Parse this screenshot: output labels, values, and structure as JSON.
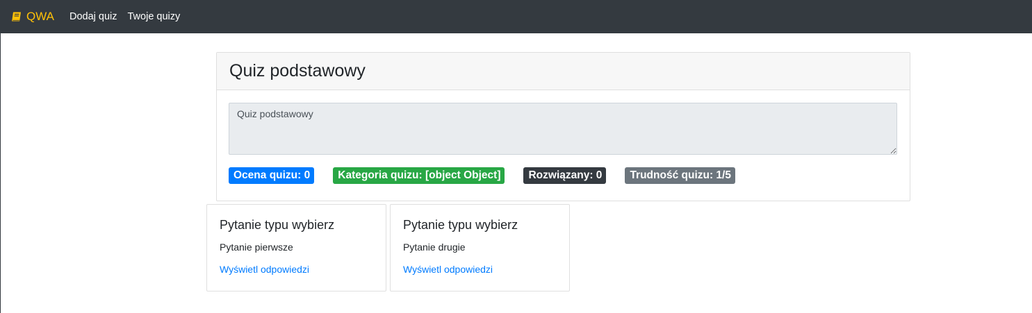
{
  "navbar": {
    "brand": "QWA",
    "brand_icon": "book-icon",
    "links": [
      "Dodaj quiz",
      "Twoje quizy"
    ],
    "brand_color": "#ffc107",
    "background": "#343a40"
  },
  "quiz": {
    "title": "Quiz podstawowy",
    "description": "Quiz podstawowy",
    "badges": {
      "rating": "Ocena quizu: 0",
      "category": "Kategoria quizu: [object Object]",
      "solved": "Rozwiązany: 0",
      "difficulty": "Trudność quizu: 1/5"
    }
  },
  "questions": [
    {
      "title": "Pytanie typu wybierz",
      "text": "Pytanie pierwsze",
      "link": "Wyświetl odpowiedzi"
    },
    {
      "title": "Pytanie typu wybierz",
      "text": "Pytanie drugie",
      "link": "Wyświetl odpowiedzi"
    }
  ]
}
